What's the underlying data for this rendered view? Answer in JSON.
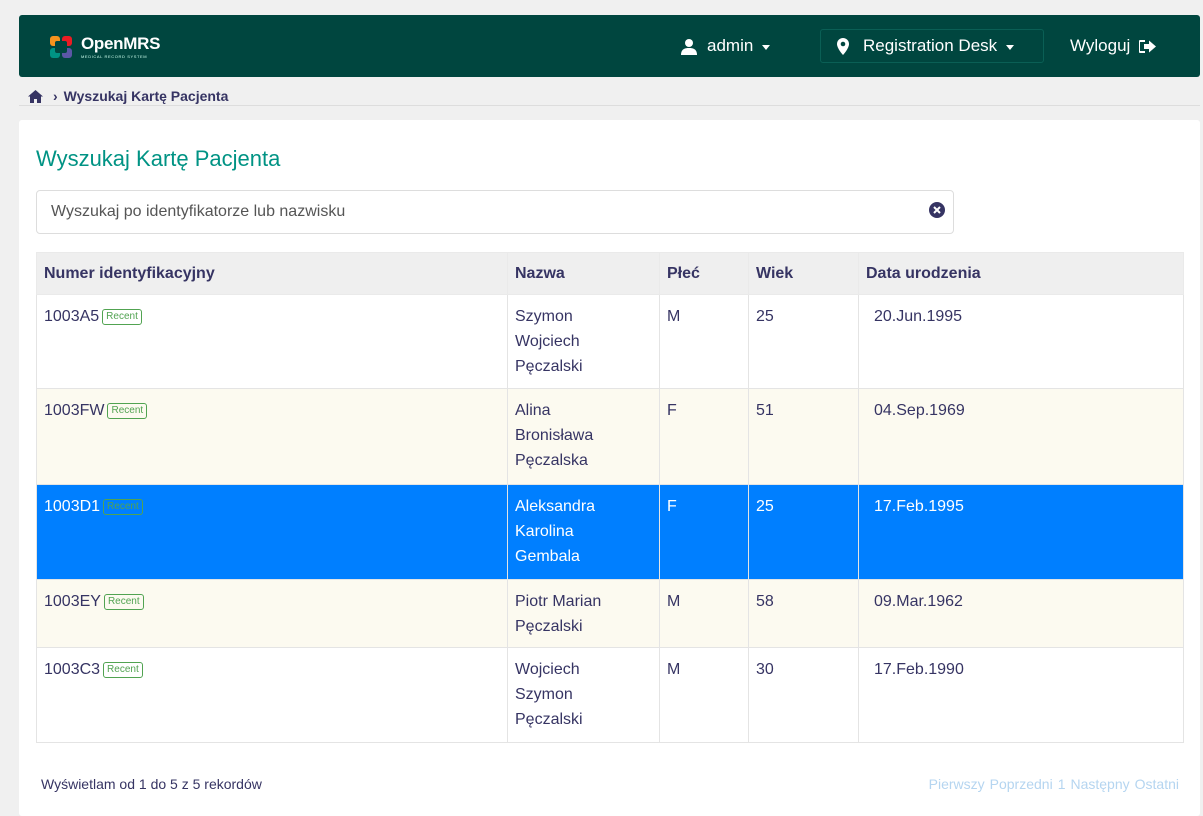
{
  "header": {
    "logo_text": "OpenMRS",
    "logo_subtext": "MEDICAL RECORD SYSTEM",
    "user_label": "admin",
    "location_label": "Registration Desk",
    "logout_label": "Wyloguj"
  },
  "breadcrumb": {
    "current": "Wyszukaj Kartę Pacjenta"
  },
  "page": {
    "title": "Wyszukaj Kartę Pacjenta",
    "search_placeholder": "Wyszukaj po identyfikatorze lub nazwisku"
  },
  "table": {
    "columns": [
      "Numer identyfikacyjny",
      "Nazwa",
      "Płeć",
      "Wiek",
      "Data urodzenia"
    ],
    "badge_label": "Recent",
    "rows": [
      {
        "id": "1003A5",
        "name": "Szymon Wojciech Pęczalski",
        "gender": "M",
        "age": "25",
        "dob": "20.Jun.1995"
      },
      {
        "id": "1003FW",
        "name": "Alina Bronisława Pęczalska",
        "gender": "F",
        "age": "51",
        "dob": "04.Sep.1969"
      },
      {
        "id": "1003D1",
        "name": "Aleksandra Karolina Gembala",
        "gender": "F",
        "age": "25",
        "dob": "17.Feb.1995"
      },
      {
        "id": "1003EY",
        "name": "Piotr Marian Pęczalski",
        "gender": "M",
        "age": "58",
        "dob": "09.Mar.1962"
      },
      {
        "id": "1003C3",
        "name": "Wojciech Szymon Pęczalski",
        "gender": "M",
        "age": "30",
        "dob": "17.Feb.1990"
      }
    ]
  },
  "footer": {
    "info": "Wyświetlam od 1 do 5 z 5 rekordów",
    "first": "Pierwszy",
    "previous": "Poprzedni",
    "page": "1",
    "next": "Następny",
    "last": "Ostatni"
  },
  "colors": {
    "header_bg": "#00463f",
    "title": "#009384",
    "selected_row": "#007fff",
    "badge": "#51a351",
    "pager": "#b5d5f0"
  }
}
